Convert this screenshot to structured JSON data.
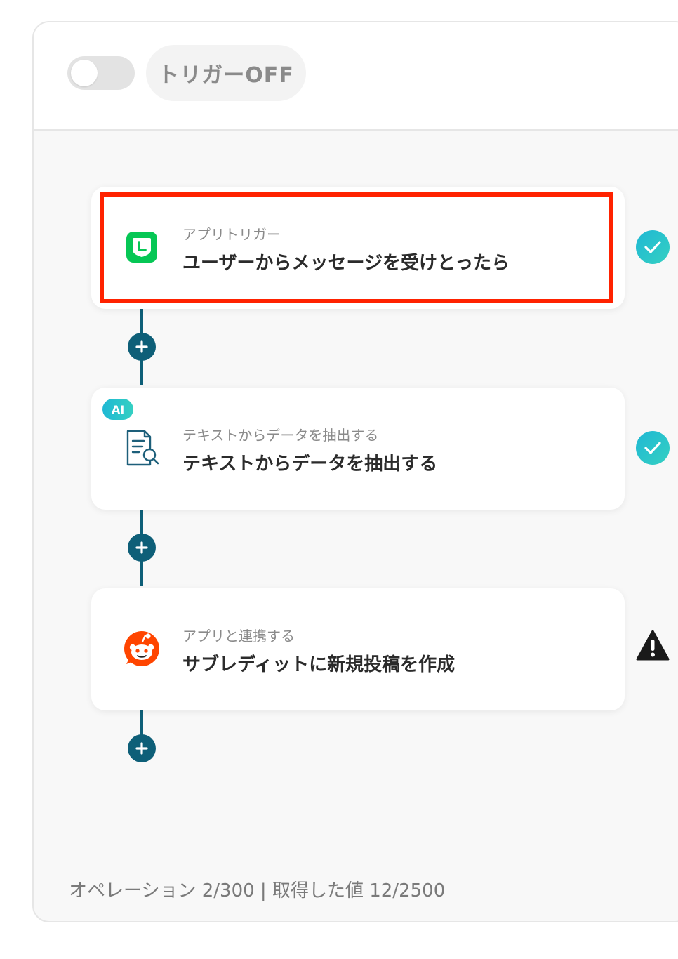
{
  "header": {
    "trigger_label": "トリガーOFF",
    "toggle_on": false
  },
  "steps": [
    {
      "subtitle": "アプリトリガー",
      "title": "ユーザーからメッセージを受けとったら",
      "icon": "line-app-icon",
      "status": "complete",
      "highlighted": true
    },
    {
      "badge": "AI",
      "subtitle": "テキストからデータを抽出する",
      "title": "テキストからデータを抽出する",
      "icon": "document-search-icon",
      "status": "complete"
    },
    {
      "subtitle": "アプリと連携する",
      "title": "サブレディットに新規投稿を作成",
      "icon": "reddit-icon",
      "status": "warning"
    }
  ],
  "footer": {
    "usage_text": "オペレーション 2/300 | 取得した値 12/2500"
  },
  "colors": {
    "connector": "#0e5f78",
    "check_gradient_start": "#1fb8d4",
    "check_gradient_end": "#35d0c2",
    "highlight": "#ff2200",
    "line_green": "#06c755",
    "reddit_orange": "#ff4500"
  }
}
